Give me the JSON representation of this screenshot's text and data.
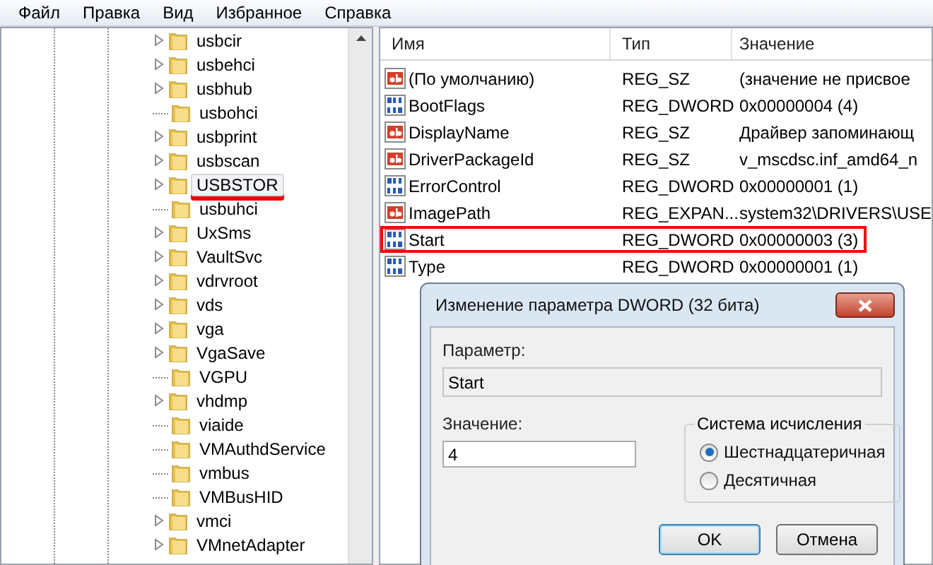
{
  "menu": [
    "Файл",
    "Правка",
    "Вид",
    "Избранное",
    "Справка"
  ],
  "tree": {
    "items": [
      {
        "label": "usbcir",
        "has_children": true,
        "selected": false,
        "marked": false
      },
      {
        "label": "usbehci",
        "has_children": true,
        "selected": false,
        "marked": false
      },
      {
        "label": "usbhub",
        "has_children": true,
        "selected": false,
        "marked": false
      },
      {
        "label": "usbohci",
        "has_children": false,
        "selected": false,
        "marked": false
      },
      {
        "label": "usbprint",
        "has_children": true,
        "selected": false,
        "marked": false
      },
      {
        "label": "usbscan",
        "has_children": true,
        "selected": false,
        "marked": false
      },
      {
        "label": "USBSTOR",
        "has_children": true,
        "selected": true,
        "marked": true
      },
      {
        "label": "usbuhci",
        "has_children": false,
        "selected": false,
        "marked": false
      },
      {
        "label": "UxSms",
        "has_children": true,
        "selected": false,
        "marked": false
      },
      {
        "label": "VaultSvc",
        "has_children": true,
        "selected": false,
        "marked": false
      },
      {
        "label": "vdrvroot",
        "has_children": true,
        "selected": false,
        "marked": false
      },
      {
        "label": "vds",
        "has_children": true,
        "selected": false,
        "marked": false
      },
      {
        "label": "vga",
        "has_children": true,
        "selected": false,
        "marked": false
      },
      {
        "label": "VgaSave",
        "has_children": true,
        "selected": false,
        "marked": false
      },
      {
        "label": "VGPU",
        "has_children": false,
        "selected": false,
        "marked": false
      },
      {
        "label": "vhdmp",
        "has_children": true,
        "selected": false,
        "marked": false
      },
      {
        "label": "viaide",
        "has_children": false,
        "selected": false,
        "marked": false
      },
      {
        "label": "VMAuthdService",
        "has_children": false,
        "selected": false,
        "marked": false
      },
      {
        "label": "vmbus",
        "has_children": false,
        "selected": false,
        "marked": false
      },
      {
        "label": "VMBusHID",
        "has_children": false,
        "selected": false,
        "marked": false
      },
      {
        "label": "vmci",
        "has_children": true,
        "selected": false,
        "marked": false
      },
      {
        "label": "VMnetAdapter",
        "has_children": true,
        "selected": false,
        "marked": false
      }
    ]
  },
  "values": {
    "columns": [
      "Имя",
      "Тип",
      "Значение"
    ],
    "rows": [
      {
        "kind": "string",
        "name": "(По умолчанию)",
        "type": "REG_SZ",
        "value": "(значение не присвое",
        "marked": false
      },
      {
        "kind": "number",
        "name": "BootFlags",
        "type": "REG_DWORD",
        "value": "0x00000004 (4)",
        "marked": false
      },
      {
        "kind": "string",
        "name": "DisplayName",
        "type": "REG_SZ",
        "value": "Драйвер запоминающ",
        "marked": false
      },
      {
        "kind": "string",
        "name": "DriverPackageId",
        "type": "REG_SZ",
        "value": "v_mscdsc.inf_amd64_n",
        "marked": false
      },
      {
        "kind": "number",
        "name": "ErrorControl",
        "type": "REG_DWORD",
        "value": "0x00000001 (1)",
        "marked": false
      },
      {
        "kind": "string",
        "name": "ImagePath",
        "type": "REG_EXPAN...",
        "value": "system32\\DRIVERS\\USE",
        "marked": false
      },
      {
        "kind": "number",
        "name": "Start",
        "type": "REG_DWORD",
        "value": "0x00000003 (3)",
        "marked": true
      },
      {
        "kind": "number",
        "name": "Type",
        "type": "REG_DWORD",
        "value": "0x00000001 (1)",
        "marked": false
      }
    ]
  },
  "dialog": {
    "title": "Изменение параметра DWORD (32 бита)",
    "param_label": "Параметр:",
    "param_value": "Start",
    "value_label": "Значение:",
    "value": "4",
    "base_group": {
      "title": "Система исчисления",
      "options": [
        {
          "label": "Шестнадцатеричная",
          "selected": true
        },
        {
          "label": "Десятичная",
          "selected": false
        }
      ]
    },
    "buttons": [
      "OK",
      "Отмена"
    ]
  }
}
